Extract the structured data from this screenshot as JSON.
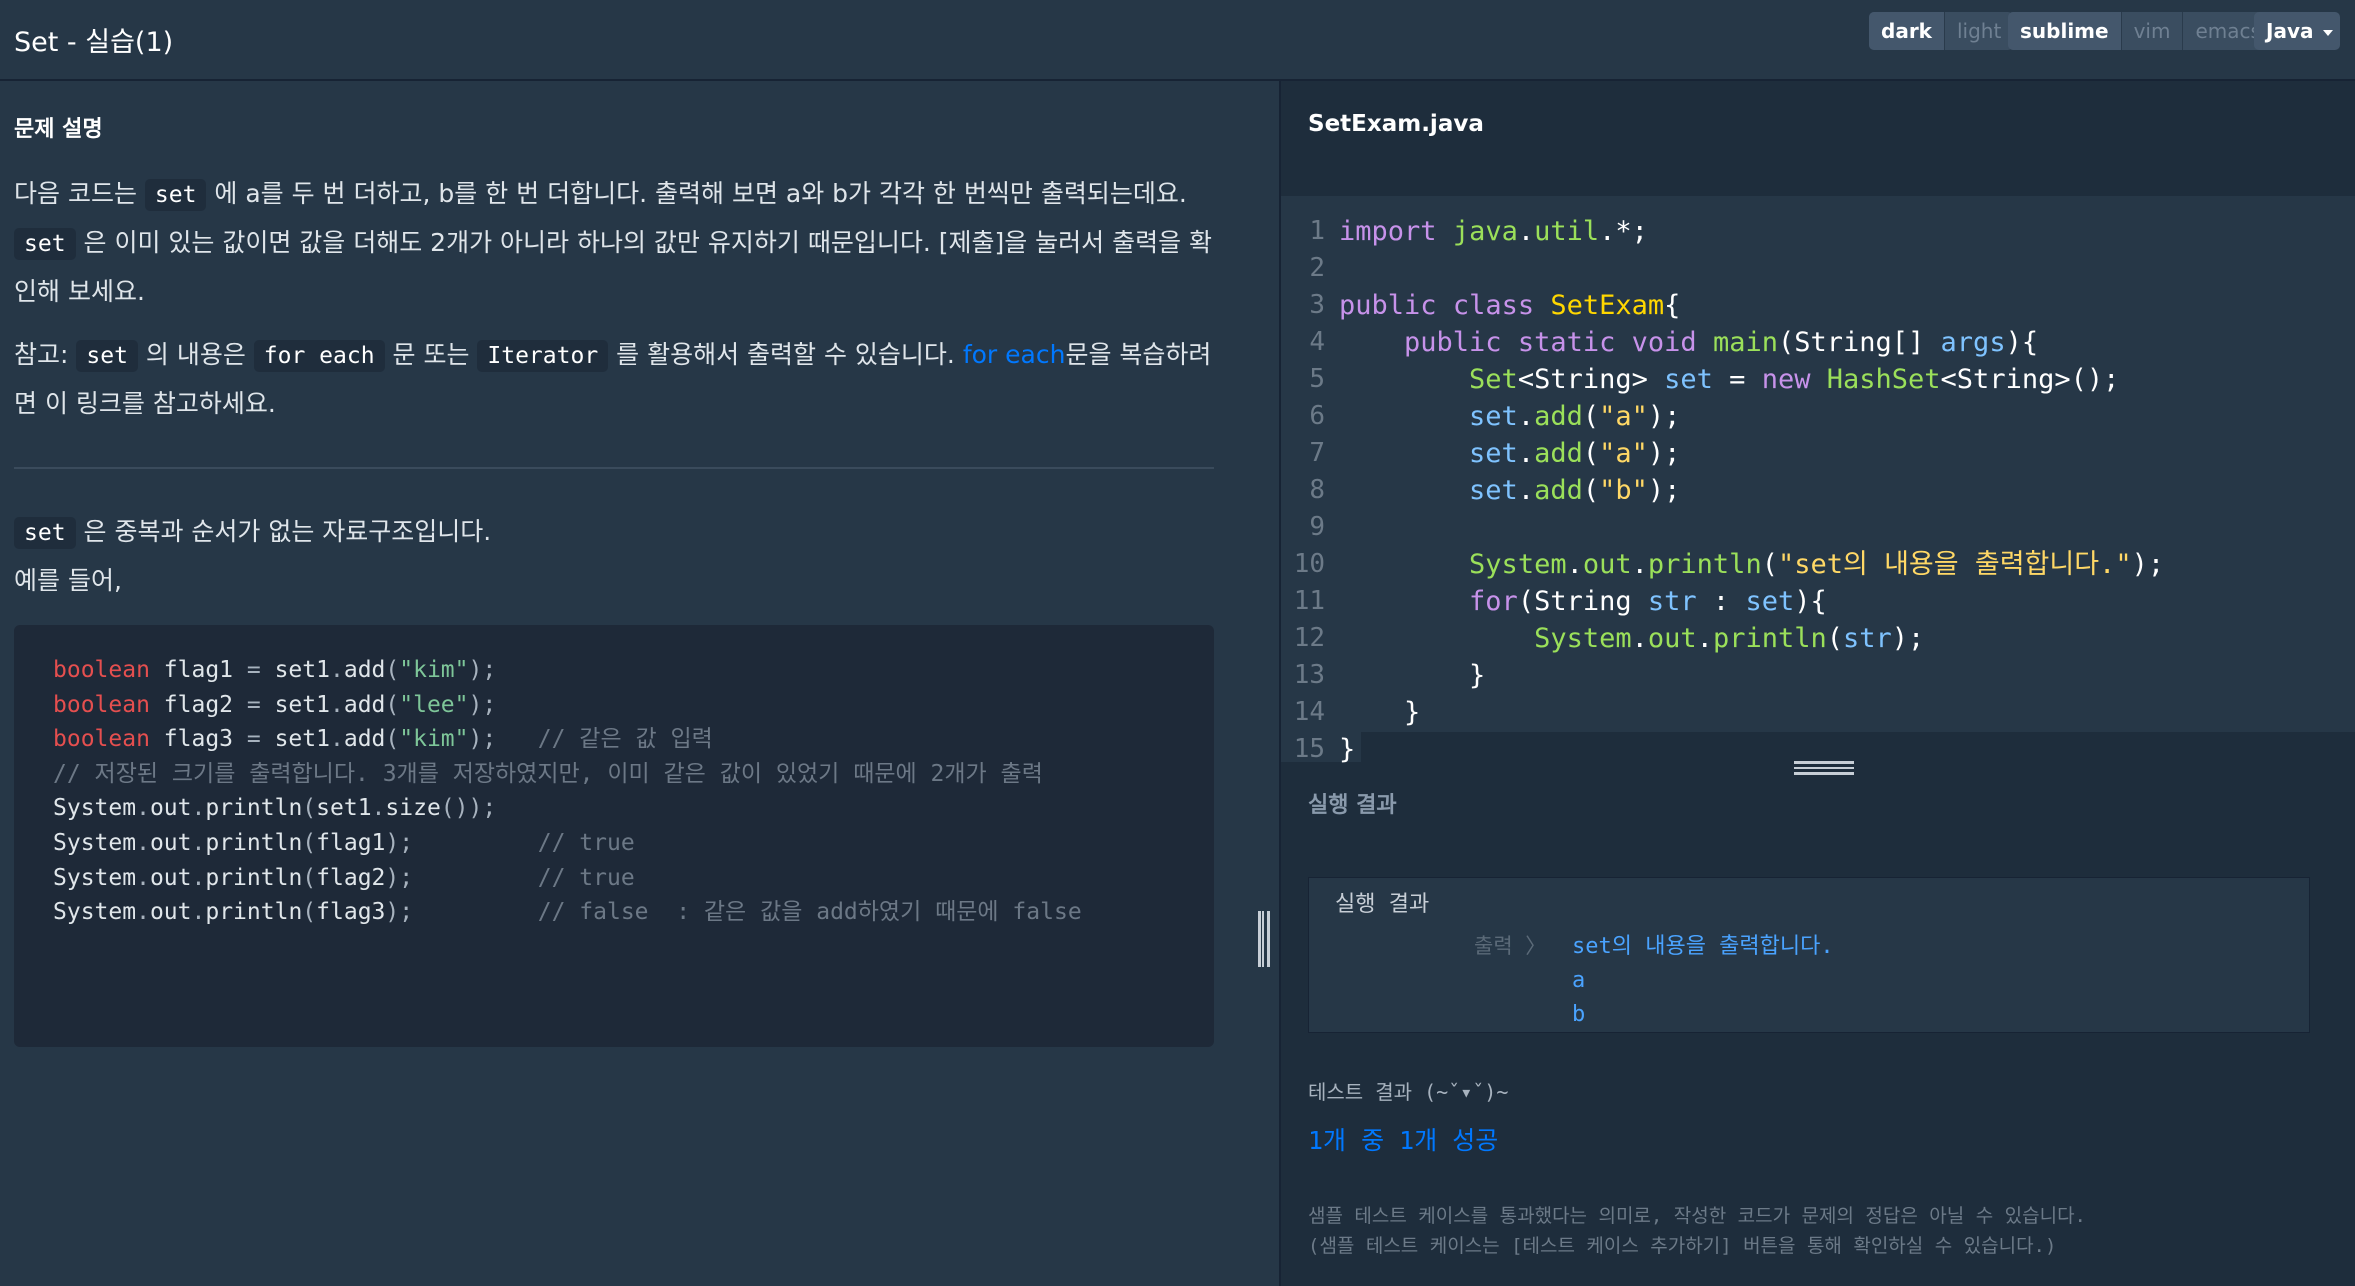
{
  "header": {
    "title": "Set - 실습(1)",
    "theme_options": [
      "dark",
      "light"
    ],
    "theme_selected": "dark",
    "keymap_options": [
      "sublime",
      "vim",
      "emacs"
    ],
    "keymap_selected": "sublime",
    "language": "Java"
  },
  "problem": {
    "section_title": "문제 설명",
    "p1": [
      {
        "t": "text",
        "v": "다음 코드는 "
      },
      {
        "t": "code",
        "v": "set"
      },
      {
        "t": "text",
        "v": " 에 a를 두 번 더하고, b를 한 번 더합니다. 출력해 보면 a와 b가 각각 한 번씩만 출력되는데요. "
      },
      {
        "t": "code",
        "v": "set"
      },
      {
        "t": "text",
        "v": " 은 이미 있는 값이면 값을 더해도 2개가 아니라 하나의 값만 유지하기 때문입니다. [제출]을 눌러서 출력을 확인해 보세요."
      }
    ],
    "p2": [
      {
        "t": "text",
        "v": "참고: "
      },
      {
        "t": "code",
        "v": "set"
      },
      {
        "t": "text",
        "v": " 의 내용은 "
      },
      {
        "t": "code",
        "v": "for each"
      },
      {
        "t": "text",
        "v": " 문 또는 "
      },
      {
        "t": "code",
        "v": "Iterator"
      },
      {
        "t": "text",
        "v": " 를 활용해서 출력할 수 있습니다. "
      },
      {
        "t": "link",
        "v": "for each"
      },
      {
        "t": "text",
        "v": "문을 복습하려면 이 링크를 참고하세요."
      }
    ],
    "p3_code": "set",
    "p3_text": " 은 중복과 순서가 없는 자료구조입니다.",
    "p4": "예를 들어,",
    "example_code": [
      [
        {
          "c": "kw-red",
          "v": "boolean"
        },
        {
          "c": "",
          "v": " flag1 "
        },
        {
          "c": "dim",
          "v": "="
        },
        {
          "c": "",
          "v": " set1"
        },
        {
          "c": "dim",
          "v": "."
        },
        {
          "c": "",
          "v": "add"
        },
        {
          "c": "dim",
          "v": "("
        },
        {
          "c": "str-green",
          "v": "\"kim\""
        },
        {
          "c": "dim",
          "v": ");"
        }
      ],
      [
        {
          "c": "kw-red",
          "v": "boolean"
        },
        {
          "c": "",
          "v": " flag2 "
        },
        {
          "c": "dim",
          "v": "="
        },
        {
          "c": "",
          "v": " set1"
        },
        {
          "c": "dim",
          "v": "."
        },
        {
          "c": "",
          "v": "add"
        },
        {
          "c": "dim",
          "v": "("
        },
        {
          "c": "str-green",
          "v": "\"lee\""
        },
        {
          "c": "dim",
          "v": ");"
        }
      ],
      [
        {
          "c": "kw-red",
          "v": "boolean"
        },
        {
          "c": "",
          "v": " flag3 "
        },
        {
          "c": "dim",
          "v": "="
        },
        {
          "c": "",
          "v": " set1"
        },
        {
          "c": "dim",
          "v": "."
        },
        {
          "c": "",
          "v": "add"
        },
        {
          "c": "dim",
          "v": "("
        },
        {
          "c": "str-green",
          "v": "\"kim\""
        },
        {
          "c": "dim",
          "v": ");"
        },
        {
          "c": "cmt",
          "v": "   // 같은 값 입력"
        }
      ],
      [
        {
          "c": "cmt",
          "v": "// 저장된 크기를 출력합니다. 3개를 저장하였지만, 이미 같은 값이 있었기 때문에 2개가 출력"
        }
      ],
      [
        {
          "c": "",
          "v": "System"
        },
        {
          "c": "dim",
          "v": "."
        },
        {
          "c": "",
          "v": "out"
        },
        {
          "c": "dim",
          "v": "."
        },
        {
          "c": "",
          "v": "println"
        },
        {
          "c": "dim",
          "v": "("
        },
        {
          "c": "",
          "v": "set1"
        },
        {
          "c": "dim",
          "v": "."
        },
        {
          "c": "",
          "v": "size"
        },
        {
          "c": "dim",
          "v": "());"
        }
      ],
      [
        {
          "c": "",
          "v": "System"
        },
        {
          "c": "dim",
          "v": "."
        },
        {
          "c": "",
          "v": "out"
        },
        {
          "c": "dim",
          "v": "."
        },
        {
          "c": "",
          "v": "println"
        },
        {
          "c": "dim",
          "v": "("
        },
        {
          "c": "",
          "v": "flag1"
        },
        {
          "c": "dim",
          "v": ");"
        },
        {
          "c": "cmt",
          "v": "         // true"
        }
      ],
      [
        {
          "c": "",
          "v": "System"
        },
        {
          "c": "dim",
          "v": "."
        },
        {
          "c": "",
          "v": "out"
        },
        {
          "c": "dim",
          "v": "."
        },
        {
          "c": "",
          "v": "println"
        },
        {
          "c": "dim",
          "v": "("
        },
        {
          "c": "",
          "v": "flag2"
        },
        {
          "c": "dim",
          "v": ");"
        },
        {
          "c": "cmt",
          "v": "         // true"
        }
      ],
      [
        {
          "c": "",
          "v": "System"
        },
        {
          "c": "dim",
          "v": "."
        },
        {
          "c": "",
          "v": "out"
        },
        {
          "c": "dim",
          "v": "."
        },
        {
          "c": "",
          "v": "println"
        },
        {
          "c": "dim",
          "v": "("
        },
        {
          "c": "",
          "v": "flag3"
        },
        {
          "c": "dim",
          "v": ");"
        },
        {
          "c": "cmt",
          "v": "         // false  : 같은 값을 add하였기 때문에 false"
        }
      ]
    ]
  },
  "editor": {
    "filename": "SetExam.java",
    "line_numbers": [
      "1",
      "2",
      "3",
      "4",
      "5",
      "6",
      "7",
      "8",
      "9",
      "10",
      "11",
      "12",
      "13",
      "14",
      "15"
    ],
    "lines": [
      [
        {
          "c": "c-kw",
          "v": "import"
        },
        {
          "c": "",
          "v": " "
        },
        {
          "c": "c-cls",
          "v": "java"
        },
        {
          "c": "",
          "v": "."
        },
        {
          "c": "c-cls",
          "v": "util"
        },
        {
          "c": "",
          "v": ".*;"
        }
      ],
      [],
      [
        {
          "c": "c-kw",
          "v": "public"
        },
        {
          "c": "",
          "v": " "
        },
        {
          "c": "c-kw",
          "v": "class"
        },
        {
          "c": "",
          "v": " "
        },
        {
          "c": "c-type",
          "v": "SetExam"
        },
        {
          "c": "",
          "v": "{"
        }
      ],
      [
        {
          "c": "",
          "v": "    "
        },
        {
          "c": "c-kw",
          "v": "public"
        },
        {
          "c": "",
          "v": " "
        },
        {
          "c": "c-kw",
          "v": "static"
        },
        {
          "c": "",
          "v": " "
        },
        {
          "c": "c-kw",
          "v": "void"
        },
        {
          "c": "",
          "v": " "
        },
        {
          "c": "c-fn",
          "v": "main"
        },
        {
          "c": "",
          "v": "(String[] "
        },
        {
          "c": "c-var",
          "v": "args"
        },
        {
          "c": "",
          "v": "){"
        }
      ],
      [
        {
          "c": "",
          "v": "        "
        },
        {
          "c": "c-cls",
          "v": "Set"
        },
        {
          "c": "",
          "v": "<String> "
        },
        {
          "c": "c-var",
          "v": "set"
        },
        {
          "c": "",
          "v": " = "
        },
        {
          "c": "c-kw",
          "v": "new"
        },
        {
          "c": "",
          "v": " "
        },
        {
          "c": "c-cls",
          "v": "HashSet"
        },
        {
          "c": "",
          "v": "<String>();"
        }
      ],
      [
        {
          "c": "",
          "v": "        "
        },
        {
          "c": "c-var",
          "v": "set"
        },
        {
          "c": "",
          "v": "."
        },
        {
          "c": "c-fn",
          "v": "add"
        },
        {
          "c": "",
          "v": "("
        },
        {
          "c": "c-str",
          "v": "\"a\""
        },
        {
          "c": "",
          "v": ");"
        }
      ],
      [
        {
          "c": "",
          "v": "        "
        },
        {
          "c": "c-var",
          "v": "set"
        },
        {
          "c": "",
          "v": "."
        },
        {
          "c": "c-fn",
          "v": "add"
        },
        {
          "c": "",
          "v": "("
        },
        {
          "c": "c-str",
          "v": "\"a\""
        },
        {
          "c": "",
          "v": ");"
        }
      ],
      [
        {
          "c": "",
          "v": "        "
        },
        {
          "c": "c-var",
          "v": "set"
        },
        {
          "c": "",
          "v": "."
        },
        {
          "c": "c-fn",
          "v": "add"
        },
        {
          "c": "",
          "v": "("
        },
        {
          "c": "c-str",
          "v": "\"b\""
        },
        {
          "c": "",
          "v": ");"
        }
      ],
      [],
      [
        {
          "c": "",
          "v": "        "
        },
        {
          "c": "c-cls",
          "v": "System"
        },
        {
          "c": "",
          "v": "."
        },
        {
          "c": "c-cls",
          "v": "out"
        },
        {
          "c": "",
          "v": "."
        },
        {
          "c": "c-fn",
          "v": "println"
        },
        {
          "c": "",
          "v": "("
        },
        {
          "c": "c-str",
          "v": "\"set의 내용을 출력합니다.\""
        },
        {
          "c": "",
          "v": ");"
        }
      ],
      [
        {
          "c": "",
          "v": "        "
        },
        {
          "c": "c-kw",
          "v": "for"
        },
        {
          "c": "",
          "v": "(String "
        },
        {
          "c": "c-var",
          "v": "str"
        },
        {
          "c": "",
          "v": " : "
        },
        {
          "c": "c-var",
          "v": "set"
        },
        {
          "c": "",
          "v": "){"
        }
      ],
      [
        {
          "c": "",
          "v": "            "
        },
        {
          "c": "c-cls",
          "v": "System"
        },
        {
          "c": "",
          "v": "."
        },
        {
          "c": "c-cls",
          "v": "out"
        },
        {
          "c": "",
          "v": "."
        },
        {
          "c": "c-fn",
          "v": "println"
        },
        {
          "c": "",
          "v": "("
        },
        {
          "c": "c-var",
          "v": "str"
        },
        {
          "c": "",
          "v": ");"
        }
      ],
      [
        {
          "c": "",
          "v": "        }"
        }
      ],
      [
        {
          "c": "",
          "v": "    }"
        }
      ],
      [
        {
          "c": "",
          "v": "}"
        }
      ]
    ]
  },
  "result": {
    "label": "실행 결과",
    "box_title": "실행 결과",
    "output_label": "출력 〉",
    "output_lines": [
      "set의 내용을 출력합니다.",
      "a",
      "b"
    ],
    "test_title": "테스트 결과 (~ˇ▾ˇ)~",
    "test_summary": "1개 중 1개 성공",
    "note_lines": [
      "샘플 테스트 케이스를 통과했다는 의미로, 작성한 코드가 문제의 정답은 아닐 수 있습니다.",
      "(샘플 테스트 케이스는 [테스트 케이스 추가하기] 버튼을 통해 확인하실 수 있습니다.)"
    ]
  }
}
